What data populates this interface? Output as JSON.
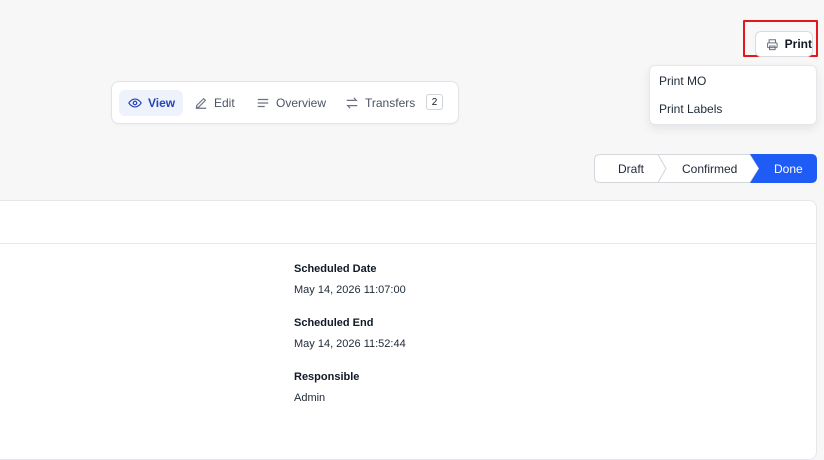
{
  "print": {
    "label": "Print",
    "menu": [
      "Print MO",
      "Print Labels"
    ]
  },
  "tabs": [
    {
      "label": "View",
      "icon": "eye-icon",
      "active": true
    },
    {
      "label": "Edit",
      "icon": "pencil-icon"
    },
    {
      "label": "Overview",
      "icon": "lines-icon"
    },
    {
      "label": "Transfers",
      "icon": "arrows-icon",
      "badge": "2"
    }
  ],
  "status": {
    "steps": [
      "Draft",
      "Confirmed",
      "Done"
    ],
    "current": "Done"
  },
  "details": {
    "scheduled_date_label": "Scheduled Date",
    "scheduled_date": "May 14, 2026 11:07:00",
    "scheduled_end_label": "Scheduled End",
    "scheduled_end": "May 14, 2026 11:52:44",
    "responsible_label": "Responsible",
    "responsible": "Admin"
  },
  "colors": {
    "accent": "#1f5cf5",
    "highlight": "#e3161b"
  }
}
